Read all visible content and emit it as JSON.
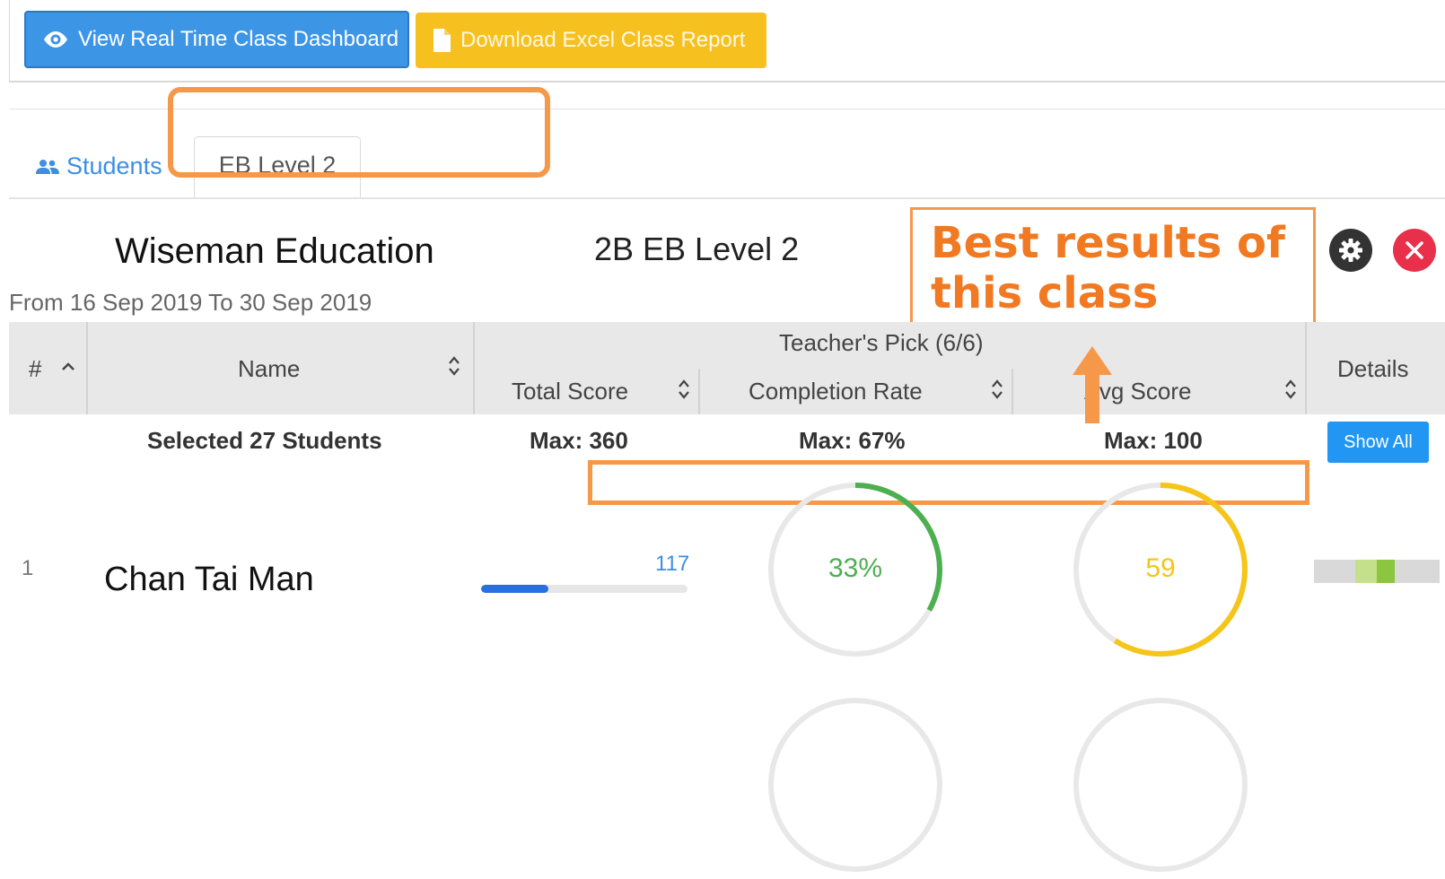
{
  "toolbar": {
    "dashboard_label": "View Real Time Class Dashboard",
    "download_label": "Download Excel Class Report"
  },
  "tabs": {
    "students_label": "Students",
    "level_label": "EB Level 2"
  },
  "header": {
    "organization": "Wiseman Education",
    "class_name": "2B EB Level 2",
    "date_range": "From 16 Sep 2019 To 30 Sep 2019"
  },
  "annotation": {
    "line1": "Best results of",
    "line2": "this class"
  },
  "table": {
    "col_num": "#",
    "col_name": "Name",
    "group_header": "Teacher's Pick (6/6)",
    "col_total": "Total Score",
    "col_completion": "Completion Rate",
    "col_avg": "Avg Score",
    "col_details": "Details"
  },
  "summary": {
    "selected": "Selected 27 Students",
    "max_total": "Max: 360",
    "max_completion": "Max: 67%",
    "max_avg": "Max: 100",
    "show_all": "Show All"
  },
  "rows": [
    {
      "num": "1",
      "name": "Chan Tai Man",
      "total_score": "117",
      "total_fraction": 0.325,
      "completion": "33%",
      "completion_fraction": 0.33,
      "avg": "59",
      "avg_fraction": 0.59
    }
  ],
  "colors": {
    "primary": "#3d95e6",
    "warning": "#f6c11f",
    "success": "#4caf50",
    "ring_yellow": "#f5c518",
    "annotation": "#f5984a",
    "danger": "#e8304a"
  },
  "icons": {
    "dashboard": "eye-icon",
    "download": "file-icon",
    "students": "users-icon",
    "settings": "gear-icon",
    "close": "close-icon",
    "sort": "sort-icon"
  }
}
